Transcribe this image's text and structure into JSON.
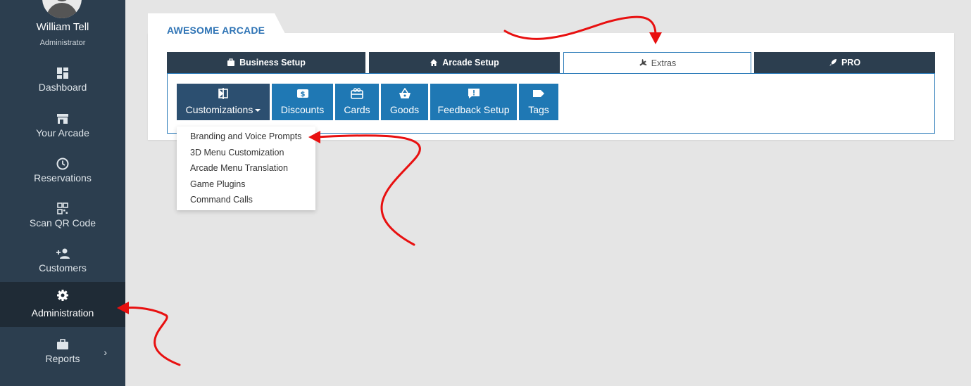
{
  "user": {
    "name": "William Tell",
    "role": "Administrator"
  },
  "sidebar": {
    "items": [
      {
        "label": "Dashboard",
        "icon": "dashboard-icon"
      },
      {
        "label": "Your Arcade",
        "icon": "store-icon"
      },
      {
        "label": "Reservations",
        "icon": "clock-icon"
      },
      {
        "label": "Scan QR Code",
        "icon": "qr-code-icon"
      },
      {
        "label": "Customers",
        "icon": "add-person-icon"
      },
      {
        "label": "Administration",
        "icon": "gear-icon",
        "active": true
      },
      {
        "label": "Reports",
        "icon": "briefcase-icon",
        "chevron": "›"
      }
    ]
  },
  "card": {
    "title": "AWESOME ARCADE"
  },
  "tabs": [
    {
      "label": "Business Setup",
      "icon": "briefcase-icon"
    },
    {
      "label": "Arcade Setup",
      "icon": "home-icon"
    },
    {
      "label": "Extras",
      "icon": "plane-icon",
      "active": true
    },
    {
      "label": "PRO",
      "icon": "rocket-icon"
    }
  ],
  "buttons": [
    {
      "label": "Customizations",
      "icon": "customize-icon",
      "dropdown": true
    },
    {
      "label": "Discounts",
      "icon": "discount-icon"
    },
    {
      "label": "Cards",
      "icon": "card-icon"
    },
    {
      "label": "Goods",
      "icon": "basket-icon"
    },
    {
      "label": "Feedback Setup",
      "icon": "feedback-icon"
    },
    {
      "label": "Tags",
      "icon": "tag-icon"
    }
  ],
  "dropdown": {
    "items": [
      "Branding and Voice Prompts",
      "3D Menu Customization",
      "Arcade Menu Translation",
      "Game Plugins",
      "Command Calls"
    ]
  },
  "colors": {
    "sidebar": "#2c3e4f",
    "accent": "#1f78b4",
    "annotation": "#e81010"
  }
}
